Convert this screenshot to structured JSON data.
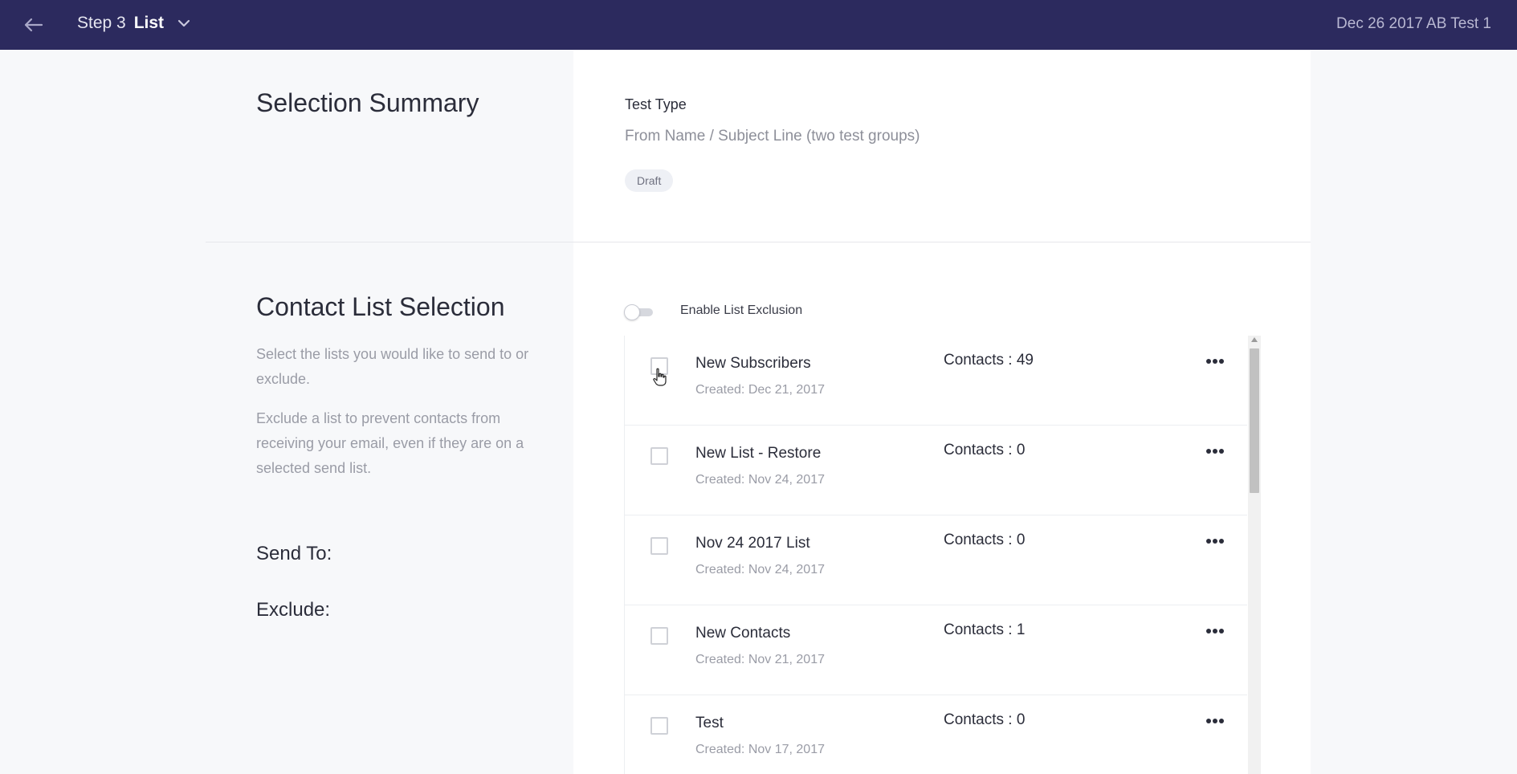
{
  "header": {
    "step_number": "Step 3",
    "step_name": "List",
    "campaign_name": "Dec 26 2017 AB Test 1"
  },
  "selection_summary": {
    "title": "Selection Summary",
    "test_type_label": "Test Type",
    "test_type_value": "From Name / Subject Line (two test groups)",
    "status_badge": "Draft"
  },
  "contact_list_selection": {
    "title": "Contact List Selection",
    "description_1": "Select the lists you would like to send to or exclude.",
    "description_2": "Exclude a list to prevent contacts from receiving your email, even if they are on a selected send list.",
    "send_to_label": "Send To:",
    "exclude_label": "Exclude:",
    "toggle_label": "Enable List Exclusion",
    "toggle_on": false
  },
  "lists": [
    {
      "name": "New Subscribers",
      "created": "Created: Dec 21, 2017",
      "contacts": "Contacts : 49",
      "checked": false
    },
    {
      "name": "New List - Restore",
      "created": "Created: Nov 24, 2017",
      "contacts": "Contacts : 0",
      "checked": false
    },
    {
      "name": "Nov 24 2017 List",
      "created": "Created: Nov 24, 2017",
      "contacts": "Contacts : 0",
      "checked": false
    },
    {
      "name": "New Contacts",
      "created": "Created: Nov 21, 2017",
      "contacts": "Contacts : 1",
      "checked": false
    },
    {
      "name": "Test",
      "created": "Created: Nov 17, 2017",
      "contacts": "Contacts : 0",
      "checked": false
    }
  ],
  "icons": {
    "back": "arrow-left-icon",
    "step_dropdown": "chevron-down-icon",
    "row_menu": "more-horizontal-icon",
    "pointer": "hand-pointer-icon"
  },
  "colors": {
    "header_bg": "#2c2a5e",
    "page_bg": "#f7f8fa",
    "panel_bg": "#ffffff"
  }
}
